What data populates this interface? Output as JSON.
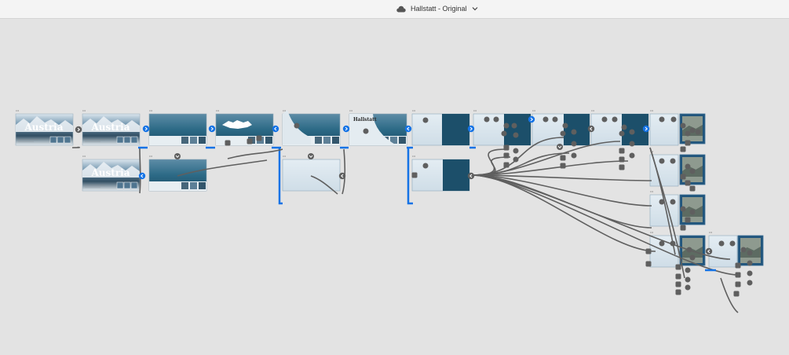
{
  "document": {
    "title": "Hallstatt - Original",
    "icon": "cloud-icon",
    "dropdown_icon": "chevron-down-icon"
  },
  "artboards": {
    "austria_label": "Austria",
    "hallstatt_label": "Hallstatt"
  },
  "colors": {
    "canvas": "#e3e3e3",
    "wire": "#5f5f5f",
    "selection": "#1473e6",
    "lake_dark": "#1c4f6a",
    "lake_light": "#dce7ee"
  }
}
